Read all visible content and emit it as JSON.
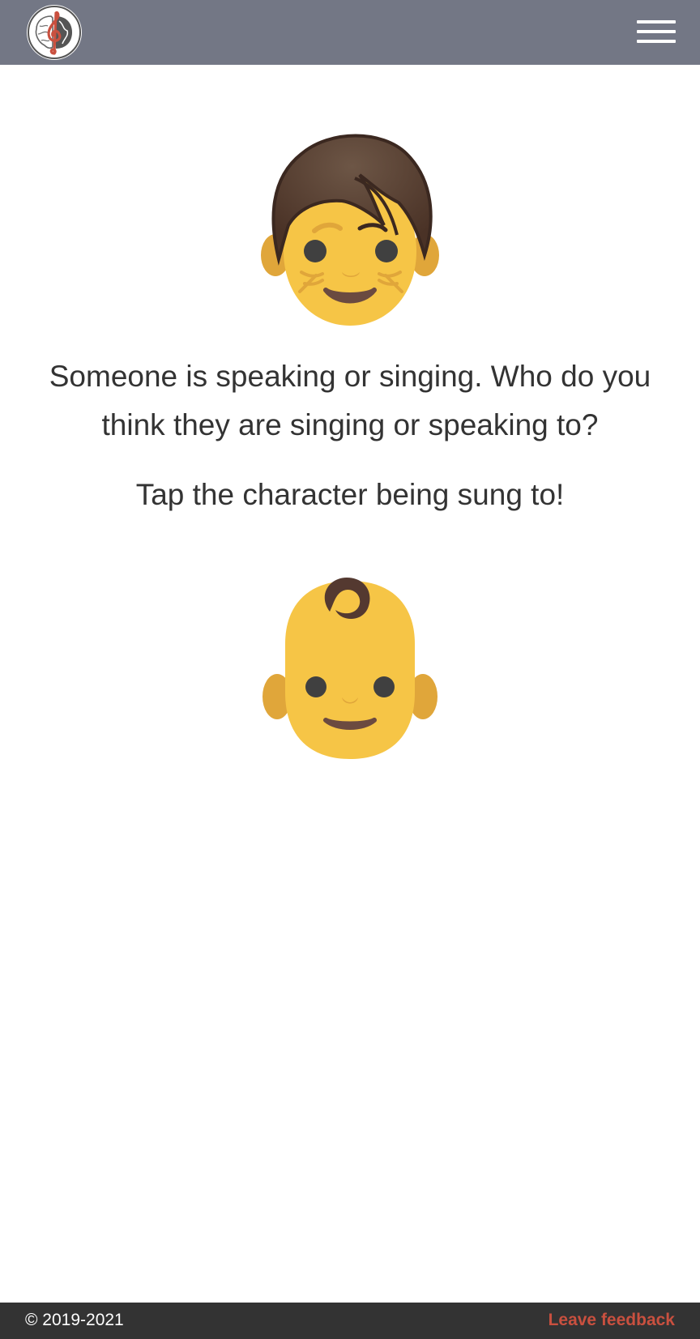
{
  "header": {
    "logo_icon": "treble-clef-brain-globe-logo",
    "menu_icon": "hamburger-menu-icon"
  },
  "main": {
    "singer_icon": "person-emoji",
    "prompt": "Someone is speaking or singing. Who do you think they are singing or speaking to?",
    "instruction": "Tap the character being sung to!",
    "target_icon": "baby-emoji"
  },
  "footer": {
    "copyright": "© 2019-2021",
    "feedback_label": "Leave feedback"
  },
  "colors": {
    "header_bg": "#737785",
    "footer_bg": "#333333",
    "accent": "#c9503f",
    "face": "#f6c546",
    "hair": "#543930"
  }
}
